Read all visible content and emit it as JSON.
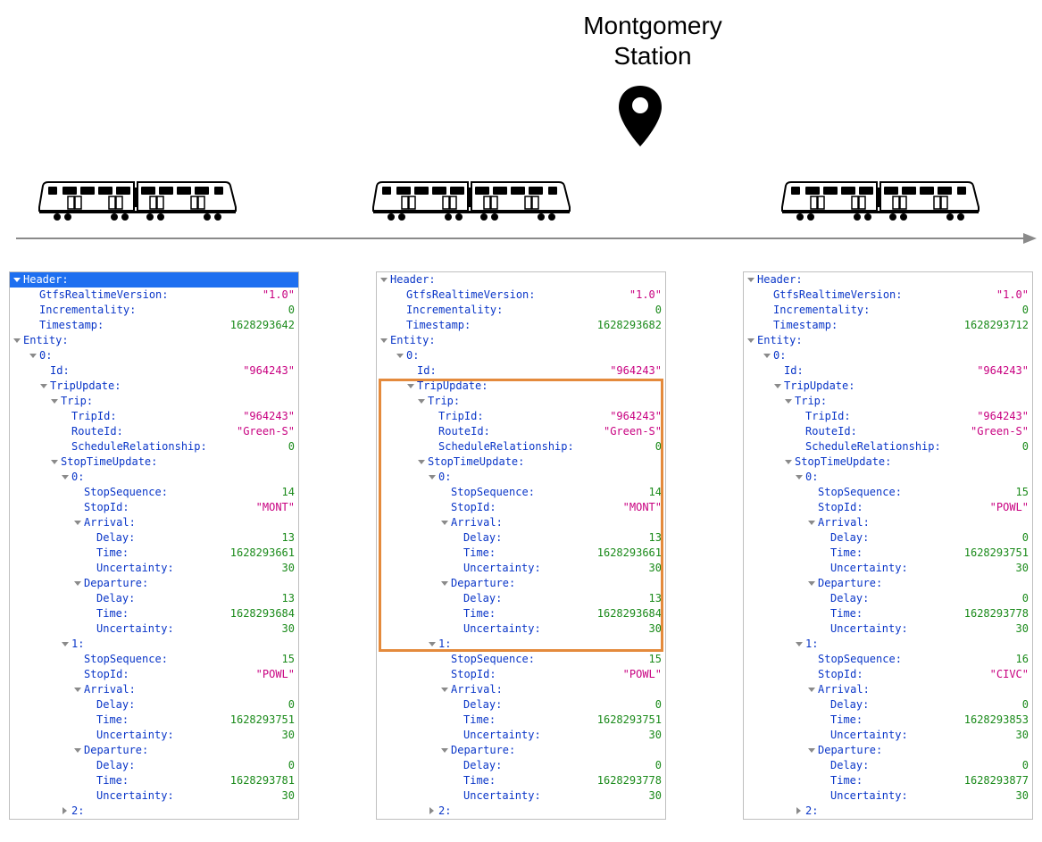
{
  "station": {
    "line1": "Montgomery",
    "line2": "Station"
  },
  "panels": [
    {
      "selected_header": true,
      "header": {
        "GtfsRealtimeVersion": "\"1.0\"",
        "Incrementality": "0",
        "Timestamp": "1628293642"
      },
      "entity": {
        "index": "0",
        "Id": "\"964243\"",
        "trip": {
          "TripId": "\"964243\"",
          "RouteId": "\"Green-S\"",
          "ScheduleRelationship": "0"
        },
        "stu": [
          {
            "idx": "0",
            "StopSequence": "14",
            "StopId": "\"MONT\"",
            "Arrival": {
              "Delay": "13",
              "Time": "1628293661",
              "Uncertainty": "30"
            },
            "Departure": {
              "Delay": "13",
              "Time": "1628293684",
              "Uncertainty": "30"
            }
          },
          {
            "idx": "1",
            "StopSequence": "15",
            "StopId": "\"POWL\"",
            "Arrival": {
              "Delay": "0",
              "Time": "1628293751",
              "Uncertainty": "30"
            },
            "Departure": {
              "Delay": "0",
              "Time": "1628293781",
              "Uncertainty": "30"
            }
          }
        ],
        "next_idx": "2"
      }
    },
    {
      "selected_header": false,
      "highlight_trip_update": true,
      "header": {
        "GtfsRealtimeVersion": "\"1.0\"",
        "Incrementality": "0",
        "Timestamp": "1628293682"
      },
      "entity": {
        "index": "0",
        "Id": "\"964243\"",
        "trip": {
          "TripId": "\"964243\"",
          "RouteId": "\"Green-S\"",
          "ScheduleRelationship": "0"
        },
        "stu": [
          {
            "idx": "0",
            "StopSequence": "14",
            "StopId": "\"MONT\"",
            "Arrival": {
              "Delay": "13",
              "Time": "1628293661",
              "Uncertainty": "30"
            },
            "Departure": {
              "Delay": "13",
              "Time": "1628293684",
              "Uncertainty": "30"
            }
          },
          {
            "idx": "1",
            "StopSequence": "15",
            "StopId": "\"POWL\"",
            "Arrival": {
              "Delay": "0",
              "Time": "1628293751",
              "Uncertainty": "30"
            },
            "Departure": {
              "Delay": "0",
              "Time": "1628293778",
              "Uncertainty": "30"
            }
          }
        ],
        "next_idx": "2"
      }
    },
    {
      "selected_header": false,
      "header": {
        "GtfsRealtimeVersion": "\"1.0\"",
        "Incrementality": "0",
        "Timestamp": "1628293712"
      },
      "entity": {
        "index": "0",
        "Id": "\"964243\"",
        "trip": {
          "TripId": "\"964243\"",
          "RouteId": "\"Green-S\"",
          "ScheduleRelationship": "0"
        },
        "stu": [
          {
            "idx": "0",
            "StopSequence": "15",
            "StopId": "\"POWL\"",
            "Arrival": {
              "Delay": "0",
              "Time": "1628293751",
              "Uncertainty": "30"
            },
            "Departure": {
              "Delay": "0",
              "Time": "1628293778",
              "Uncertainty": "30"
            }
          },
          {
            "idx": "1",
            "StopSequence": "16",
            "StopId": "\"CIVC\"",
            "Arrival": {
              "Delay": "0",
              "Time": "1628293853",
              "Uncertainty": "30"
            },
            "Departure": {
              "Delay": "0",
              "Time": "1628293877",
              "Uncertainty": "30"
            }
          }
        ],
        "next_idx": "2"
      }
    }
  ],
  "labels": {
    "Header": "Header:",
    "GtfsRealtimeVersion": "GtfsRealtimeVersion:",
    "Incrementality": "Incrementality:",
    "Timestamp": "Timestamp:",
    "Entity": "Entity:",
    "Id": "Id:",
    "TripUpdate": "TripUpdate:",
    "Trip": "Trip:",
    "TripId": "TripId:",
    "RouteId": "RouteId:",
    "ScheduleRelationship": "ScheduleRelationship:",
    "StopTimeUpdate": "StopTimeUpdate:",
    "StopSequence": "StopSequence:",
    "StopId": "StopId:",
    "Arrival": "Arrival:",
    "Departure": "Departure:",
    "Delay": "Delay:",
    "Time": "Time:",
    "Uncertainty": "Uncertainty:"
  }
}
